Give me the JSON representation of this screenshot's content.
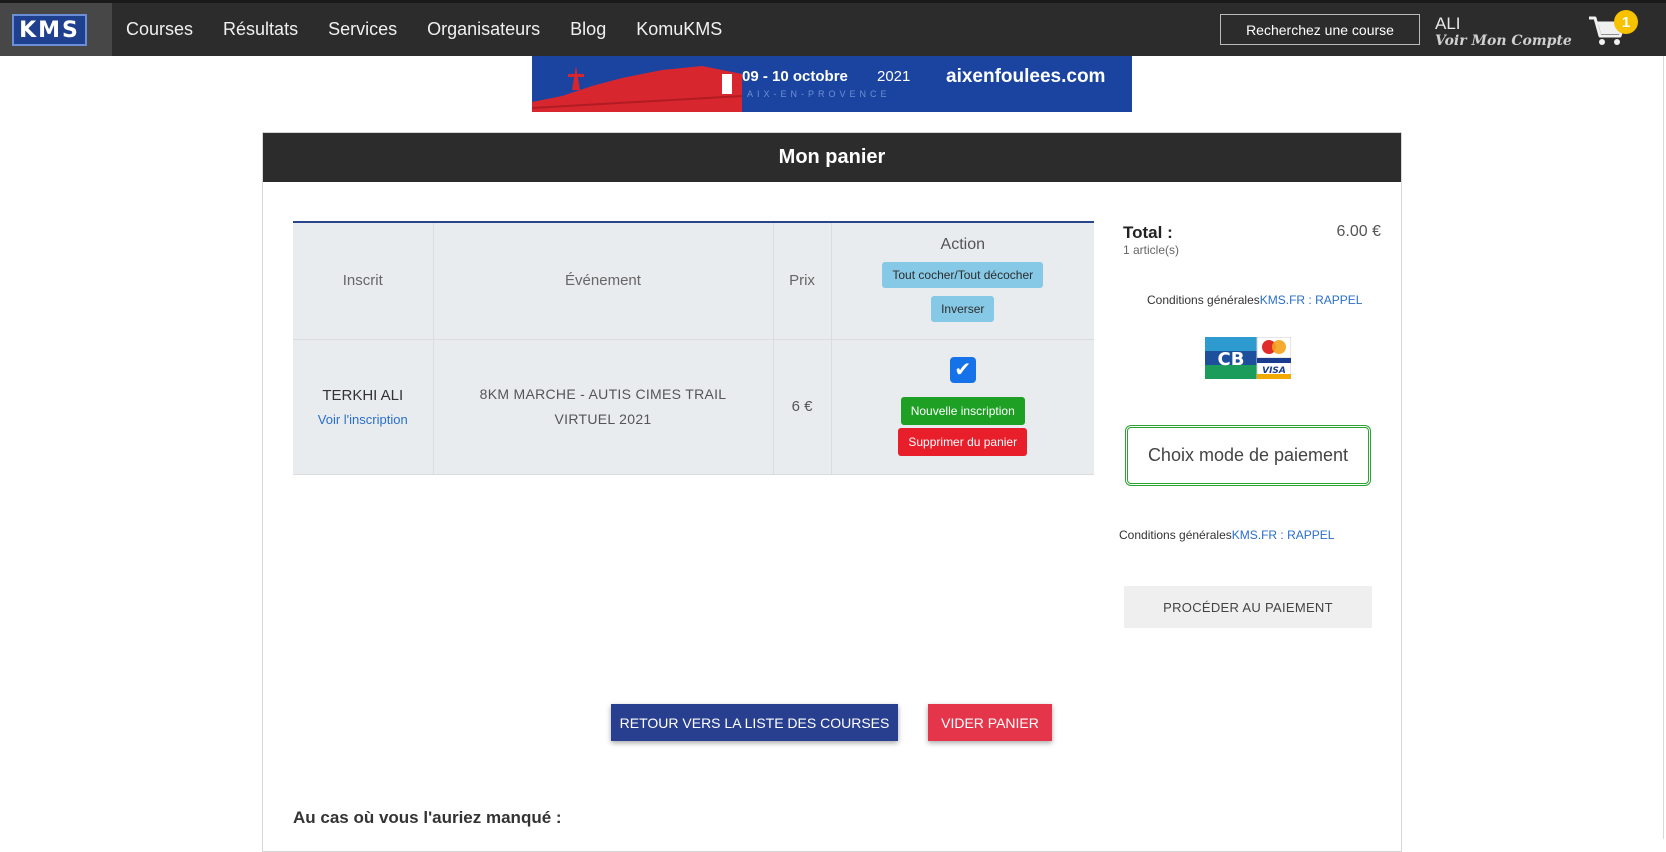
{
  "navbar": {
    "logo_text": "KMS",
    "items": [
      "Courses",
      "Résultats",
      "Services",
      "Organisateurs",
      "Blog",
      "KomuKMS"
    ],
    "search_label": "Recherchez une course",
    "user_name": "ALI",
    "account_label": "Voir Mon Compte",
    "cart_count": "1"
  },
  "banner": {
    "date": "09 - 10 octobre",
    "year": "2021",
    "subtitle": "AIX-EN-PROVENCE",
    "site": "aixenfoulees.com"
  },
  "panel": {
    "title": "Mon panier"
  },
  "table": {
    "headers": {
      "inscrit": "Inscrit",
      "evenement": "Événement",
      "prix": "Prix",
      "action": "Action"
    },
    "select_all_label": "Tout cocher/Tout décocher",
    "invert_label": "Inverser",
    "rows": [
      {
        "name": "TERKHI ALI",
        "view_link": "Voir l'inscription",
        "event": "8KM MARCHE - AUTIS CIMES TRAIL VIRTUEL 2021",
        "price": "6 €",
        "checked": true,
        "new_label": "Nouvelle inscription",
        "remove_label": "Supprimer du panier"
      }
    ]
  },
  "summary": {
    "total_label": "Total :",
    "total_value": "6.00 €",
    "articles": "1 article(s)",
    "conditions_label": "Conditions générales",
    "conditions_link": "KMS.FR : RAPPEL",
    "payment_mode_label": "Choix mode de paiement",
    "proceed_label": "PROCÉDER AU PAIEMENT"
  },
  "actions": {
    "back_label": "RETOUR VERS LA LISTE DES COURSES",
    "empty_label": "VIDER PANIER"
  },
  "missed_heading": "Au cas où vous l'auriez manqué :",
  "colors": {
    "navbar": "#2c2c2c",
    "accent_blue": "#283f8f",
    "green": "#1ea024",
    "red": "#e81f2a",
    "cart_badge": "#f7c200"
  }
}
